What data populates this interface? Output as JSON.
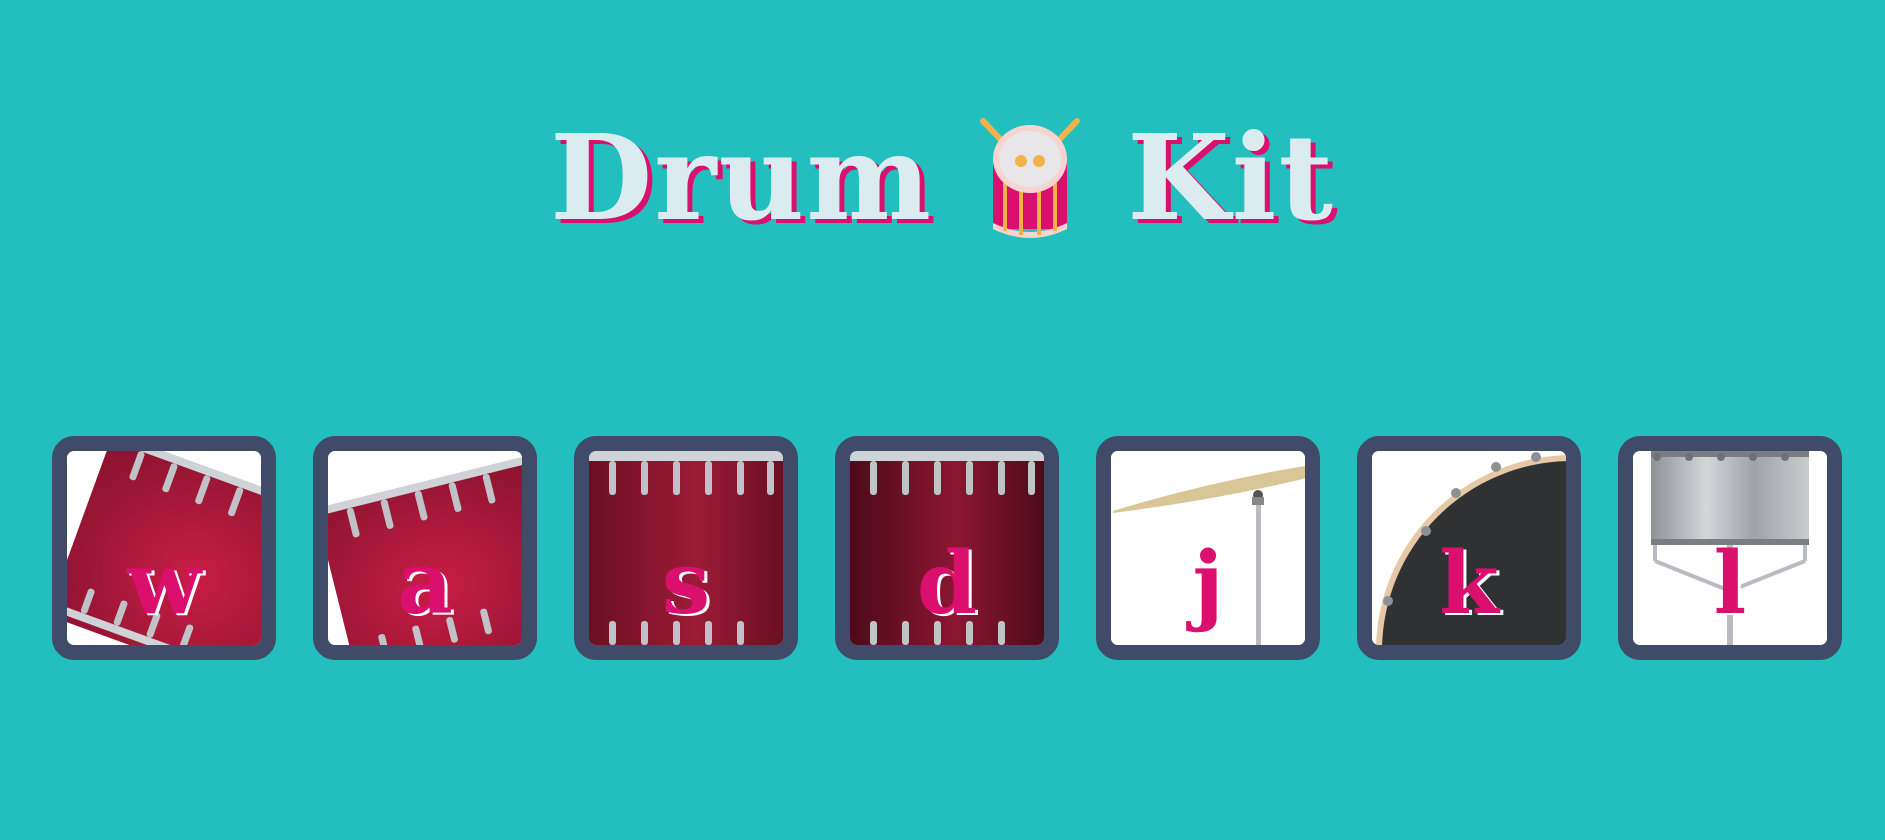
{
  "title": {
    "word_left": "Drum",
    "word_right": "Kit",
    "emoji_icon": "drum-icon"
  },
  "pads": [
    {
      "key": "w",
      "instrument_icon": "tom-drum-tilted-icon"
    },
    {
      "key": "a",
      "instrument_icon": "tom-drum-tilted-icon"
    },
    {
      "key": "s",
      "instrument_icon": "snare-drum-icon"
    },
    {
      "key": "d",
      "instrument_icon": "snare-drum-icon"
    },
    {
      "key": "j",
      "instrument_icon": "crash-cymbal-icon"
    },
    {
      "key": "k",
      "instrument_icon": "kick-drum-icon"
    },
    {
      "key": "l",
      "instrument_icon": "hi-hat-icon"
    }
  ],
  "colors": {
    "background": "#23bfbe",
    "title_text": "#daecef",
    "accent": "#db0f6e",
    "pad_border": "#404b69",
    "pad_background": "#ffffff"
  }
}
